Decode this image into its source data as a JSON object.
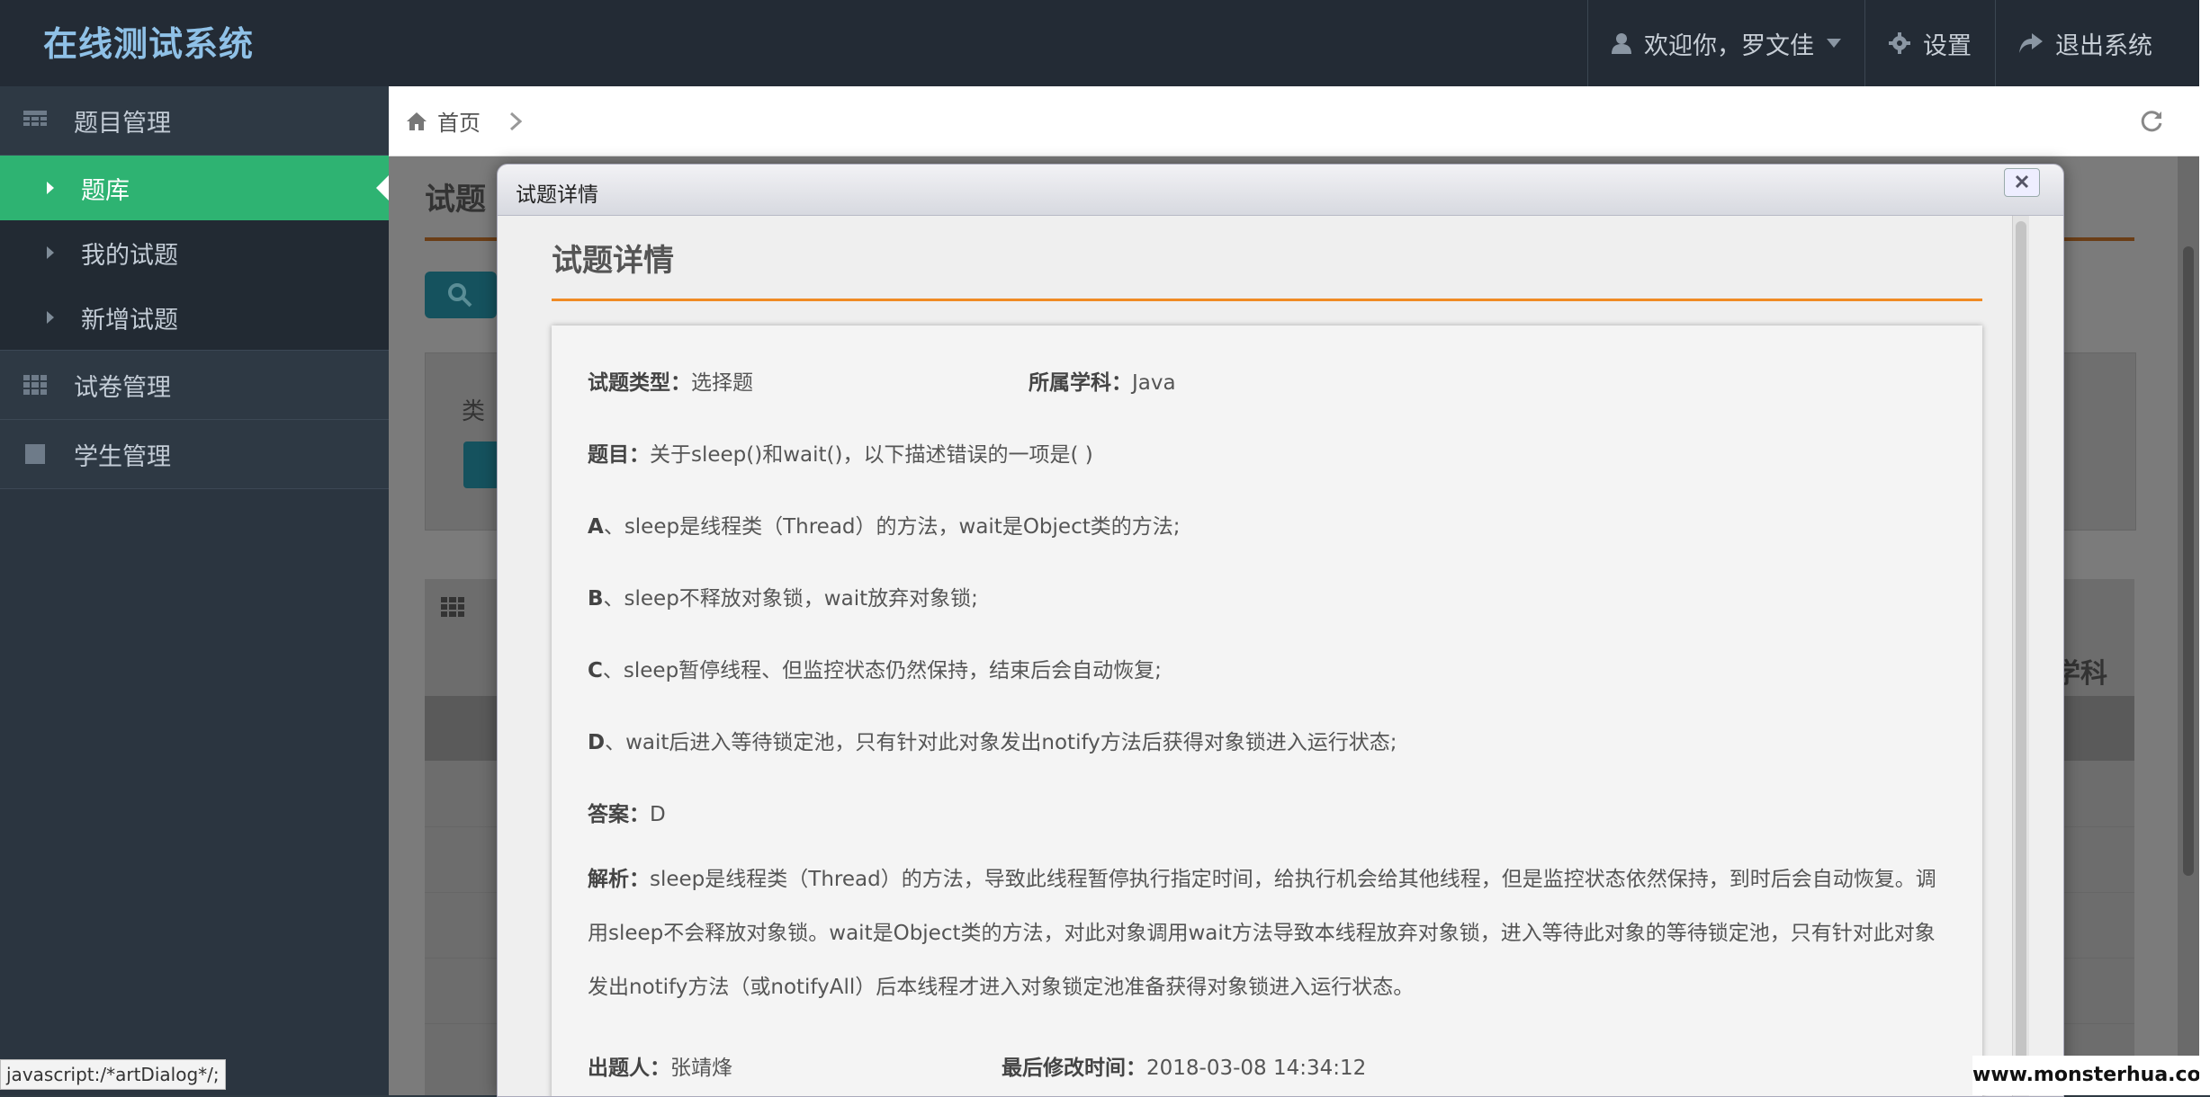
{
  "header": {
    "brand": "在线测试系统",
    "user_menu": "欢迎你，罗文佳",
    "settings": "设置",
    "logout": "退出系统"
  },
  "sidebar": {
    "groups": [
      {
        "label": "题目管理",
        "icon": "table-icon"
      },
      {
        "label": "试卷管理",
        "icon": "grid-icon"
      },
      {
        "label": "学生管理",
        "icon": "square-icon"
      }
    ],
    "sub_items": [
      {
        "label": "题库",
        "active": true
      },
      {
        "label": "我的试题",
        "active": false
      },
      {
        "label": "新增试题",
        "active": false
      }
    ]
  },
  "breadcrumb": {
    "home": "首页"
  },
  "background": {
    "page_title": "试题",
    "panel_label": "类",
    "table_header_right": "学科"
  },
  "dialog": {
    "title": "试题详情",
    "heading": "试题详情",
    "type_label": "试题类型：",
    "type_value": "选择题",
    "subject_label": "所属学科：",
    "subject_value": "Java",
    "question_label": "题目：",
    "question_value": "关于sleep()和wait()，以下描述错误的一项是( )",
    "option_a_label": "A",
    "option_a_value": "、sleep是线程类（Thread）的方法，wait是Object类的方法;",
    "option_b_label": "B",
    "option_b_value": "、sleep不释放对象锁，wait放弃对象锁;",
    "option_c_label": "C",
    "option_c_value": "、sleep暂停线程、但监控状态仍然保持，结束后会自动恢复;",
    "option_d_label": "D",
    "option_d_value": "、wait后进入等待锁定池，只有针对此对象发出notify方法后获得对象锁进入运行状态;",
    "answer_label": "答案：",
    "answer_value": "D",
    "analysis_label": "解析：",
    "analysis_value": "sleep是线程类（Thread）的方法，导致此线程暂停执行指定时间，给执行机会给其他线程，但是监控状态依然保持，到时后会自动恢复。调用sleep不会释放对象锁。wait是Object类的方法，对此对象调用wait方法导致本线程放弃对象锁，进入等待此对象的等待锁定池，只有针对此对象发出notify方法（或notifyAll）后本线程才进入对象锁定池准备获得对象锁进入运行状态。",
    "author_label": "出题人：",
    "author_value": "张靖烽",
    "modified_label": "最后修改时间：",
    "modified_value": "2018-03-08 14:34:12"
  },
  "status_bar": "javascript:/*artDialog*/;",
  "watermark": "www.monsterhua.com"
}
